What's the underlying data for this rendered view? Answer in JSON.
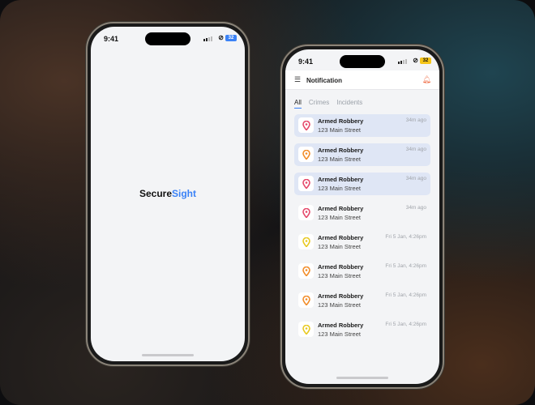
{
  "status": {
    "time": "9:41",
    "battery": "32"
  },
  "splash": {
    "brand_a": "Secure",
    "brand_b": "Sight"
  },
  "app": {
    "title": "Notification",
    "tabs": [
      {
        "label": "All"
      },
      {
        "label": "Crimes"
      },
      {
        "label": "Incidents"
      }
    ]
  },
  "colors": {
    "accent": "#3b82f6",
    "red": "#e5486a",
    "orange": "#f28c28",
    "yellow": "#e8c920"
  },
  "notifications": [
    {
      "title": "Armed Robbery",
      "address": "123 Main Street",
      "time": "34m ago",
      "color": "#e5486a",
      "unread": true
    },
    {
      "title": "Armed Robbery",
      "address": "123 Main Street",
      "time": "34m ago",
      "color": "#f28c28",
      "unread": true
    },
    {
      "title": "Armed Robbery",
      "address": "123 Main Street",
      "time": "34m ago",
      "color": "#e5486a",
      "unread": true
    },
    {
      "title": "Armed Robbery",
      "address": "123 Main Street",
      "time": "34m ago",
      "color": "#e5486a",
      "unread": false
    },
    {
      "title": "Armed Robbery",
      "address": "123 Main Street",
      "time": "Fri 5 Jan, 4:26pm",
      "color": "#e8c920",
      "unread": false
    },
    {
      "title": "Armed Robbery",
      "address": "123 Main Street",
      "time": "Fri 5 Jan, 4:26pm",
      "color": "#f28c28",
      "unread": false
    },
    {
      "title": "Armed Robbery",
      "address": "123 Main Street",
      "time": "Fri 5 Jan, 4:26pm",
      "color": "#f28c28",
      "unread": false
    },
    {
      "title": "Armed Robbery",
      "address": "123 Main Street",
      "time": "Fri 5 Jan, 4:26pm",
      "color": "#e8c920",
      "unread": false
    }
  ]
}
